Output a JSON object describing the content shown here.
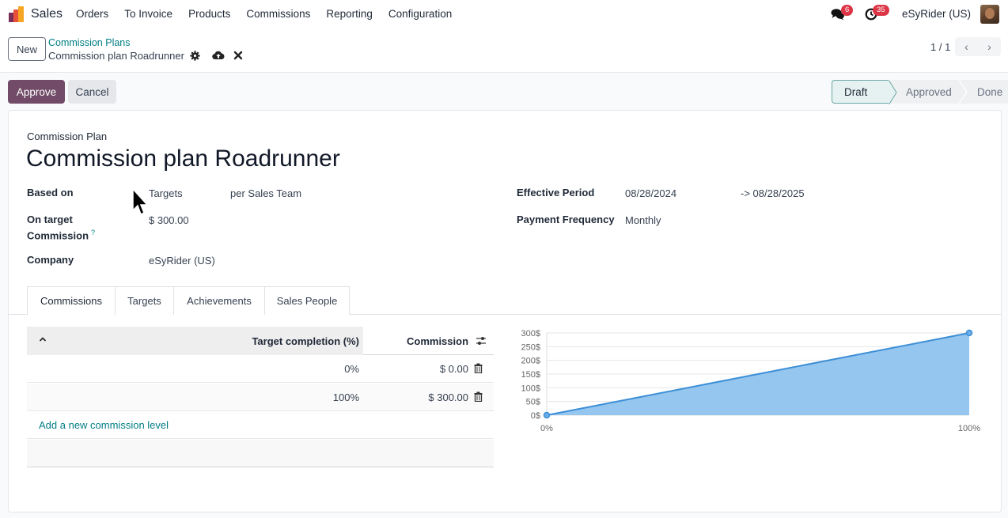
{
  "navbar": {
    "app_name": "Sales",
    "menu": [
      "Orders",
      "To Invoice",
      "Products",
      "Commissions",
      "Reporting",
      "Configuration"
    ],
    "messages_count": "6",
    "activities_count": "35",
    "company": "eSyRider (US)"
  },
  "control_panel": {
    "new_label": "New",
    "breadcrumb_parent": "Commission Plans",
    "breadcrumb_current": "Commission plan Roadrunner",
    "pager_value": "1 / 1",
    "pager_prev": "‹",
    "pager_next": "›"
  },
  "statusbar": {
    "approve_label": "Approve",
    "cancel_label": "Cancel",
    "stages": [
      {
        "label": "Draft",
        "active": true
      },
      {
        "label": "Approved",
        "active": false
      },
      {
        "label": "Done",
        "active": false
      }
    ]
  },
  "form": {
    "subtitle": "Commission Plan",
    "title": "Commission plan Roadrunner",
    "based_on_label": "Based on",
    "based_on_value": "Targets",
    "based_on_scope": "per Sales Team",
    "on_target_label_1": "On target",
    "on_target_label_2": "Commission",
    "help_mark": "?",
    "on_target_value": "$ 300.00",
    "company_label": "Company",
    "company_value": "eSyRider (US)",
    "effective_period_label": "Effective Period",
    "effective_start": "08/28/2024",
    "effective_end": "-> 08/28/2025",
    "payment_frequency_label": "Payment Frequency",
    "payment_frequency_value": "Monthly"
  },
  "tabs": [
    {
      "label": "Commissions",
      "active": true
    },
    {
      "label": "Targets",
      "active": false
    },
    {
      "label": "Achievements",
      "active": false
    },
    {
      "label": "Sales People",
      "active": false
    }
  ],
  "levels_table": {
    "headers": {
      "target": "Target completion (%)",
      "commission": "Commission"
    },
    "rows": [
      {
        "target": "0%",
        "commission": "$ 0.00"
      },
      {
        "target": "100%",
        "commission": "$ 300.00"
      }
    ],
    "add_line_label": "Add a new commission level"
  },
  "chart_data": {
    "type": "area",
    "title": "",
    "xlabel": "",
    "ylabel": "",
    "x": [
      0,
      100
    ],
    "x_tick_labels": [
      "0%",
      "100%"
    ],
    "series": [
      {
        "name": "Commission",
        "values": [
          0,
          300
        ],
        "color": "#3d8fd6",
        "fill": "#8fc3ee"
      }
    ],
    "y_ticks": [
      0,
      50,
      100,
      150,
      200,
      250,
      300
    ],
    "y_tick_labels": [
      "0$",
      "50$",
      "100$",
      "150$",
      "200$",
      "250$",
      "300$"
    ],
    "ylim": [
      0,
      300
    ],
    "xlim": [
      0,
      100
    ],
    "grid": true,
    "legend": "none"
  },
  "colors": {
    "primary": "#714b67",
    "link": "#017e84",
    "badge": "#dc3545"
  }
}
